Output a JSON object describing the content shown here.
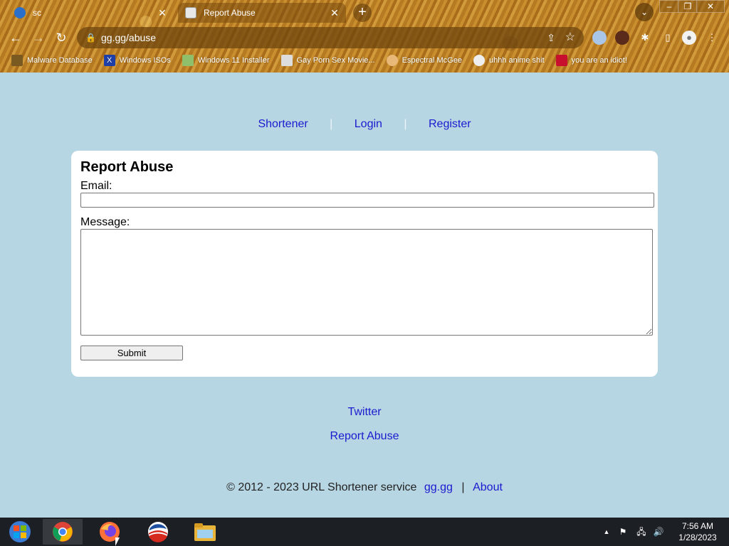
{
  "browser": {
    "tabs": [
      {
        "title": "sc",
        "close_glyph": "✕"
      },
      {
        "title": "Report Abuse",
        "close_glyph": "✕"
      }
    ],
    "new_tab_glyph": "+",
    "tab_search_glyph": "⌄",
    "window_controls": {
      "minimize": "–",
      "maximize": "❐",
      "close": "✕"
    },
    "nav": {
      "back": "←",
      "forward": "→",
      "reload": "↻"
    },
    "address": "gg.gg/abuse",
    "lock_glyph": "🔒",
    "share_glyph": "⇪",
    "star_glyph": "☆",
    "extensions": {
      "puzzle": "✱",
      "sidepanel": "▯",
      "profile": "●",
      "menu": "⋮"
    },
    "bookmarks": [
      {
        "label": "Malware Database",
        "icon": "brown-icon",
        "color": "#7a5a20"
      },
      {
        "label": "Windows ISOs",
        "icon": "x-icon",
        "color": "#1f3fa8"
      },
      {
        "label": "Windows 11 Installer",
        "icon": "image-icon",
        "color": "#8fbf6a"
      },
      {
        "label": "Gay Porn Sex Movie...",
        "icon": "box-icon",
        "color": "#dddddd"
      },
      {
        "label": "Espectral McGee",
        "icon": "face-icon",
        "color": "#e8b878"
      },
      {
        "label": "uhhh anime shit",
        "icon": "anime-icon",
        "color": "#eeeeee"
      },
      {
        "label": "you are an idiot!",
        "icon": "flag-icon",
        "color": "#c8102e"
      }
    ]
  },
  "page": {
    "nav": {
      "shortener": "Shortener",
      "login": "Login",
      "register": "Register",
      "separator": "|"
    },
    "form": {
      "title": "Report Abuse",
      "email_label": "Email:",
      "email_value": "",
      "message_label": "Message:",
      "message_value": "",
      "submit_label": "Submit"
    },
    "footer": {
      "twitter": "Twitter",
      "report_abuse": "Report Abuse",
      "copyright": "© 2012 - 2023 URL Shortener service",
      "site_link": "gg.gg",
      "separator": "|",
      "about": "About"
    }
  },
  "taskbar": {
    "clock_time": "7:56 AM",
    "clock_date": "1/28/2023",
    "tray": {
      "up": "▲",
      "flag": "⚑",
      "network": "🖧",
      "volume": "🔊"
    }
  },
  "colors": {
    "page_bg": "#b7d6e3",
    "link": "#1a1acf",
    "card_bg": "#ffffff",
    "taskbar_bg": "#1c1f24"
  }
}
